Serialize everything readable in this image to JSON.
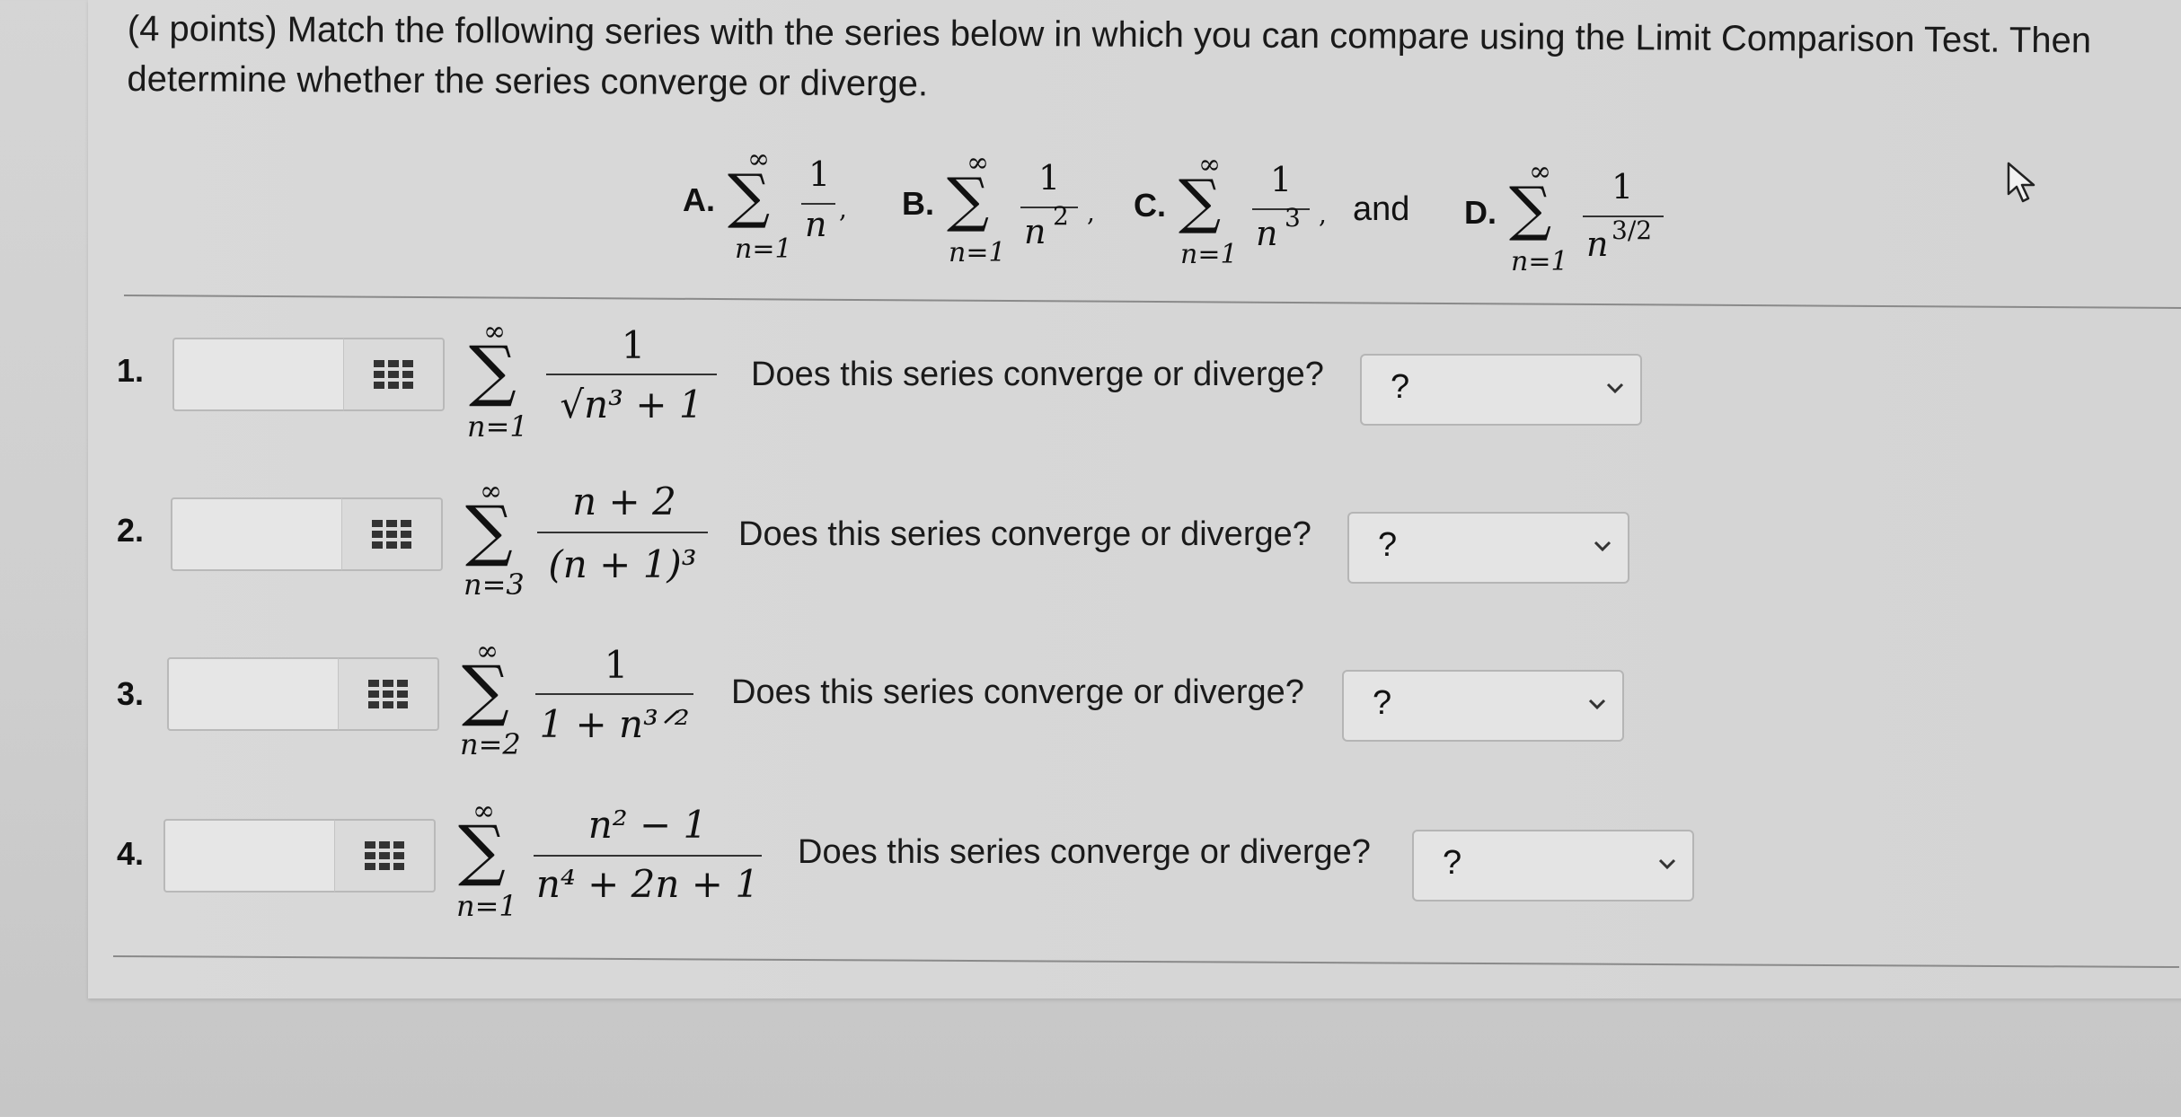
{
  "question": {
    "text": "(4 points) Match the following series with the series below in which you can compare using the Limit Comparison Test. Then determine whether the series converge or diverge."
  },
  "options": [
    {
      "letter": "A.",
      "upper": "∞",
      "lower": "n=1",
      "numerator": "1",
      "denominator": "n",
      "sep": ","
    },
    {
      "letter": "B.",
      "upper": "∞",
      "lower": "n=1",
      "numerator": "1",
      "denominator": "n",
      "den_exp": "2",
      "sep": ","
    },
    {
      "letter": "C.",
      "upper": "∞",
      "lower": "n=1",
      "numerator": "1",
      "denominator": "n",
      "den_exp": "3",
      "sep": ","
    },
    {
      "letter": "D.",
      "upper": "∞",
      "lower": "n=1",
      "numerator": "1",
      "denominator": "n",
      "den_exp": "3/2",
      "sep": ""
    }
  ],
  "and_text": "and",
  "problems": [
    {
      "number": "1.",
      "upper": "∞",
      "lower": "n=1",
      "numerator": "1",
      "denominator": "√n³ + 1",
      "answer": "",
      "prompt": "Does this series converge or diverge?",
      "selection": "?"
    },
    {
      "number": "2.",
      "upper": "∞",
      "lower": "n=3",
      "numerator": "n + 2",
      "denominator": "(n + 1)³",
      "answer": "",
      "prompt": "Does this series converge or diverge?",
      "selection": "?"
    },
    {
      "number": "3.",
      "upper": "∞",
      "lower": "n=2",
      "numerator": "1",
      "denominator": "1 + n³ᐟ²",
      "answer": "",
      "prompt": "Does this series converge or diverge?",
      "selection": "?"
    },
    {
      "number": "4.",
      "upper": "∞",
      "lower": "n=1",
      "numerator": "n² − 1",
      "denominator": "n⁴ + 2n + 1",
      "answer": "",
      "prompt": "Does this series converge or diverge?",
      "selection": "?"
    }
  ],
  "icons": {
    "matrix": "grid-icon",
    "dropdown": "chevron-down-icon",
    "cursor": "mouse-pointer-icon"
  },
  "colors": {
    "page": "#d5d5d5",
    "box": "#e6e6e6",
    "border": "#b5b5b5"
  }
}
